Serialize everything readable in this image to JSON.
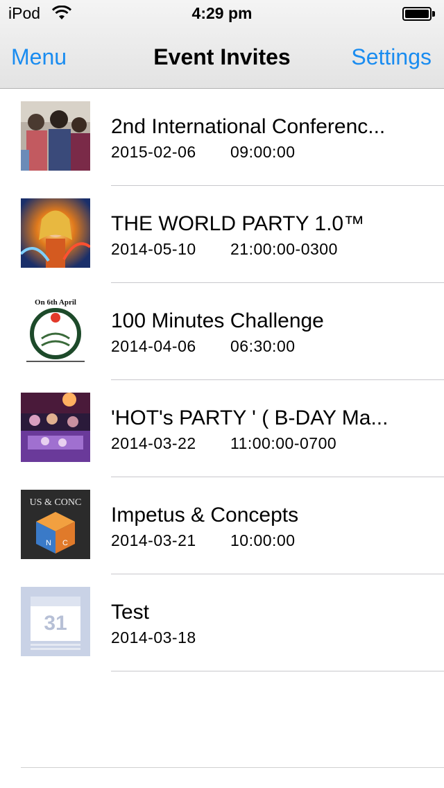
{
  "status_bar": {
    "carrier": "iPod",
    "time": "4:29 pm",
    "wifi_icon": "wifi-icon",
    "battery_icon": "battery-full-icon"
  },
  "nav": {
    "left_label": "Menu",
    "title": "Event Invites",
    "right_label": "Settings",
    "accent": "#1a8cf0"
  },
  "events": [
    {
      "title": "2nd International Conferenc...",
      "date": "2015-02-06",
      "time": "09:00:00",
      "thumb": "conference-crowd-photo"
    },
    {
      "title": "THE WORLD PARTY 1.0™",
      "date": "2014-05-10",
      "time": "21:00:00-0300",
      "thumb": "party-poster-image"
    },
    {
      "title": "100 Minutes Challenge",
      "date": "2014-04-06",
      "time": "06:30:00",
      "thumb": "challenge-logo-image",
      "thumb_text": "On 6th April"
    },
    {
      "title": "'HOT's PARTY ' ( B-DAY Ma...",
      "date": "2014-03-22",
      "time": "11:00:00-0700",
      "thumb": "nightclub-crowd-photo"
    },
    {
      "title": "Impetus & Concepts",
      "date": "2014-03-21",
      "time": "10:00:00",
      "thumb": "cube-logo-image",
      "thumb_text": "US & CONC"
    },
    {
      "title": "Test",
      "date": "2014-03-18",
      "time": "",
      "thumb": "calendar-placeholder-icon",
      "thumb_text": "31"
    }
  ]
}
